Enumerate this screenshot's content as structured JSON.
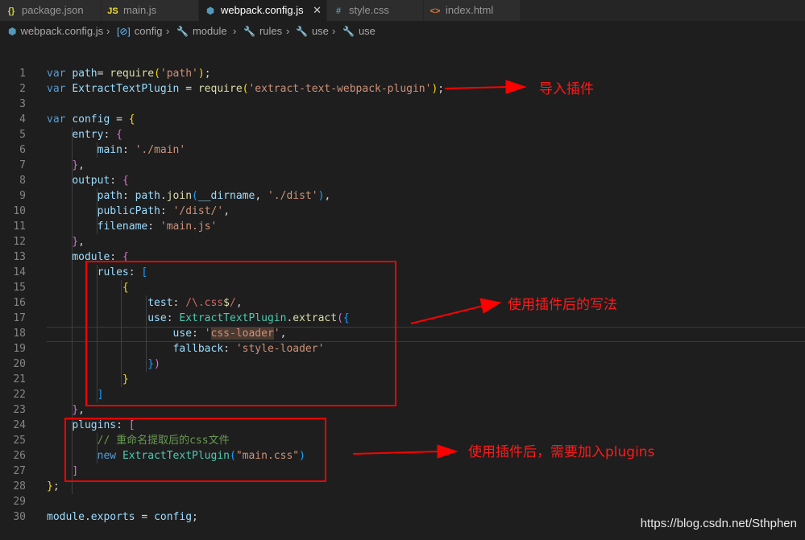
{
  "tabs": [
    {
      "icon": "{}",
      "icon_color": "#cbcb41",
      "label": "package.json"
    },
    {
      "icon": "JS",
      "icon_color": "#f1dd35",
      "label": "main.js"
    },
    {
      "icon": "⬢",
      "icon_color": "#519aba",
      "label": "webpack.config.js",
      "close": "✕"
    },
    {
      "icon": "#",
      "icon_color": "#519aba",
      "label": "style.css"
    },
    {
      "icon": "<>",
      "icon_color": "#e37933",
      "label": "index.html"
    }
  ],
  "breadcrumb": [
    {
      "icon": "⬢",
      "label": "webpack.config.js"
    },
    {
      "icon": "[⊘]",
      "label": "config"
    },
    {
      "icon": "🔧",
      "label": "module"
    },
    {
      "icon": "🔧",
      "label": "rules"
    },
    {
      "icon": "🔧",
      "label": "use"
    },
    {
      "icon": "🔧",
      "label": "use"
    }
  ],
  "code": {
    "lines": [
      {
        "n": "1",
        "parts": [
          [
            "kw",
            "var "
          ],
          [
            "var",
            "path"
          ],
          [
            "",
            "= "
          ],
          [
            "fn",
            "require"
          ],
          [
            "b1",
            "("
          ],
          [
            "str",
            "'path'"
          ],
          [
            "b1",
            ")"
          ],
          [
            "",
            ";"
          ]
        ]
      },
      {
        "n": "2",
        "parts": [
          [
            "kw",
            "var "
          ],
          [
            "var",
            "ExtractTextPlugin"
          ],
          [
            "",
            " = "
          ],
          [
            "fn",
            "require"
          ],
          [
            "b1",
            "("
          ],
          [
            "str",
            "'extract-text-webpack-plugin'"
          ],
          [
            "b1",
            ")"
          ],
          [
            "",
            ";"
          ]
        ]
      },
      {
        "n": "3",
        "parts": []
      },
      {
        "n": "4",
        "parts": [
          [
            "kw",
            "var "
          ],
          [
            "var",
            "config"
          ],
          [
            "",
            " = "
          ],
          [
            "b1",
            "{"
          ]
        ]
      },
      {
        "n": "5",
        "parts": [
          [
            "",
            "    "
          ],
          [
            "var",
            "entry"
          ],
          [
            "",
            ": "
          ],
          [
            "b2",
            "{"
          ]
        ]
      },
      {
        "n": "6",
        "parts": [
          [
            "",
            "        "
          ],
          [
            "var",
            "main"
          ],
          [
            "",
            ": "
          ],
          [
            "str",
            "'./main'"
          ]
        ]
      },
      {
        "n": "7",
        "parts": [
          [
            "",
            "    "
          ],
          [
            "b2",
            "}"
          ],
          [
            "",
            ","
          ]
        ]
      },
      {
        "n": "8",
        "parts": [
          [
            "",
            "    "
          ],
          [
            "var",
            "output"
          ],
          [
            "",
            ": "
          ],
          [
            "b2",
            "{"
          ]
        ]
      },
      {
        "n": "9",
        "parts": [
          [
            "",
            "        "
          ],
          [
            "var",
            "path"
          ],
          [
            "",
            ": "
          ],
          [
            "var",
            "path"
          ],
          [
            "",
            "."
          ],
          [
            "fn",
            "join"
          ],
          [
            "b3",
            "("
          ],
          [
            "var",
            "__dirname"
          ],
          [
            "",
            ", "
          ],
          [
            "str",
            "'./dist'"
          ],
          [
            "b3",
            ")"
          ],
          [
            "",
            ","
          ]
        ]
      },
      {
        "n": "10",
        "parts": [
          [
            "",
            "        "
          ],
          [
            "var",
            "publicPath"
          ],
          [
            "",
            ": "
          ],
          [
            "str",
            "'/dist/'"
          ],
          [
            "",
            ","
          ]
        ]
      },
      {
        "n": "11",
        "parts": [
          [
            "",
            "        "
          ],
          [
            "var",
            "filename"
          ],
          [
            "",
            ": "
          ],
          [
            "str",
            "'main.js'"
          ]
        ]
      },
      {
        "n": "12",
        "parts": [
          [
            "",
            "    "
          ],
          [
            "b2",
            "}"
          ],
          [
            "",
            ","
          ]
        ]
      },
      {
        "n": "13",
        "parts": [
          [
            "",
            "    "
          ],
          [
            "var",
            "module"
          ],
          [
            "",
            ": "
          ],
          [
            "b2",
            "{"
          ]
        ]
      },
      {
        "n": "14",
        "parts": [
          [
            "",
            "        "
          ],
          [
            "var",
            "rules"
          ],
          [
            "",
            ": "
          ],
          [
            "b3",
            "["
          ]
        ]
      },
      {
        "n": "15",
        "parts": [
          [
            "",
            "            "
          ],
          [
            "b1",
            "{"
          ]
        ]
      },
      {
        "n": "16",
        "parts": [
          [
            "",
            "                "
          ],
          [
            "var",
            "test"
          ],
          [
            "",
            ": "
          ],
          [
            "rx",
            "/\\.css"
          ],
          [
            "rxs",
            "$"
          ],
          [
            "rx",
            "/"
          ],
          [
            "",
            ","
          ]
        ]
      },
      {
        "n": "17",
        "parts": [
          [
            "",
            "                "
          ],
          [
            "var",
            "use"
          ],
          [
            "",
            ": "
          ],
          [
            "cls",
            "ExtractTextPlugin"
          ],
          [
            "",
            "."
          ],
          [
            "fn",
            "extract"
          ],
          [
            "b2",
            "("
          ],
          [
            "b3",
            "{"
          ]
        ]
      },
      {
        "n": "18",
        "parts": [
          [
            "",
            "                    "
          ],
          [
            "var",
            "use"
          ],
          [
            "",
            ": "
          ],
          [
            "str",
            "'"
          ],
          [
            "str hl",
            "css-loader"
          ],
          [
            "str",
            "'"
          ],
          [
            "",
            ","
          ]
        ]
      },
      {
        "n": "19",
        "parts": [
          [
            "",
            "                    "
          ],
          [
            "var",
            "fallback"
          ],
          [
            "",
            ": "
          ],
          [
            "str",
            "'style-loader'"
          ]
        ]
      },
      {
        "n": "20",
        "parts": [
          [
            "",
            "                "
          ],
          [
            "b3",
            "}"
          ],
          [
            "b2",
            ")"
          ]
        ]
      },
      {
        "n": "21",
        "parts": [
          [
            "",
            "            "
          ],
          [
            "b1",
            "}"
          ]
        ]
      },
      {
        "n": "22",
        "parts": [
          [
            "",
            "        "
          ],
          [
            "b3",
            "]"
          ]
        ]
      },
      {
        "n": "23",
        "parts": [
          [
            "",
            "    "
          ],
          [
            "b2",
            "}"
          ],
          [
            "",
            ","
          ]
        ]
      },
      {
        "n": "24",
        "parts": [
          [
            "",
            "    "
          ],
          [
            "var",
            "plugins"
          ],
          [
            "",
            ": "
          ],
          [
            "b2",
            "["
          ]
        ]
      },
      {
        "n": "25",
        "parts": [
          [
            "",
            "        "
          ],
          [
            "cm",
            "// 重命名提取后的css文件"
          ]
        ]
      },
      {
        "n": "26",
        "parts": [
          [
            "",
            "        "
          ],
          [
            "kw",
            "new "
          ],
          [
            "cls",
            "ExtractTextPlugin"
          ],
          [
            "b3",
            "("
          ],
          [
            "str",
            "\"main.css\""
          ],
          [
            "b3",
            ")"
          ]
        ]
      },
      {
        "n": "27",
        "parts": [
          [
            "",
            "    "
          ],
          [
            "b2",
            "]"
          ]
        ]
      },
      {
        "n": "28",
        "parts": [
          [
            "b1",
            "}"
          ],
          [
            "",
            ";"
          ]
        ]
      },
      {
        "n": "29",
        "parts": []
      },
      {
        "n": "30",
        "parts": [
          [
            "var",
            "module"
          ],
          [
            "",
            "."
          ],
          [
            "var",
            "exports"
          ],
          [
            "",
            " = "
          ],
          [
            "var",
            "config"
          ],
          [
            "",
            ";"
          ]
        ]
      }
    ]
  },
  "annotations": {
    "import_plugin": "导入插件",
    "usage_after_plugin": "使用插件后的写法",
    "add_plugins": "使用插件后，需要加入plugins",
    "color": "#ff0000"
  },
  "watermark": "https://blog.csdn.net/Sthphen"
}
